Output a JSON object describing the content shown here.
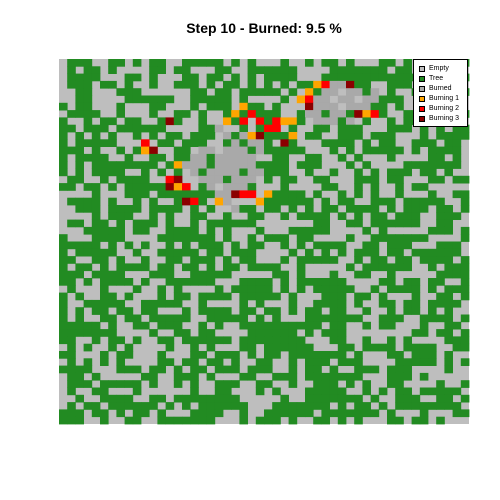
{
  "chart_data": {
    "type": "heatmap",
    "title": "Step 10 - Burned: 9.5 %",
    "step": 10,
    "burned_percent": 9.5,
    "grid_size": [
      50,
      50
    ],
    "colors": {
      "empty": "#bebebe",
      "tree": "#228b22",
      "burned": "#a9a9a9",
      "burning1": "#ffa500",
      "burning2": "#ff0000",
      "burning3": "#8b0000"
    },
    "legend": [
      {
        "label": "Empty",
        "state": "empty"
      },
      {
        "label": "Tree",
        "state": "tree"
      },
      {
        "label": "Burned",
        "state": "burned"
      },
      {
        "label": "Burning 1",
        "state": "burning1"
      },
      {
        "label": "Burning 2",
        "state": "burning2"
      },
      {
        "label": "Burning 3",
        "state": "burning3"
      }
    ],
    "legend_position": "top-right",
    "tree_density": 0.6,
    "burned_cells": [
      [
        9,
        19
      ],
      [
        10,
        20
      ],
      [
        10,
        22
      ],
      [
        11,
        21
      ],
      [
        11,
        23
      ],
      [
        11,
        24
      ],
      [
        12,
        17
      ],
      [
        12,
        18
      ],
      [
        12,
        20
      ],
      [
        12,
        21
      ],
      [
        12,
        22
      ],
      [
        12,
        24
      ],
      [
        13,
        16
      ],
      [
        13,
        17
      ],
      [
        13,
        19
      ],
      [
        13,
        20
      ],
      [
        13,
        21
      ],
      [
        13,
        22
      ],
      [
        13,
        23
      ],
      [
        14,
        15
      ],
      [
        14,
        16
      ],
      [
        14,
        17
      ],
      [
        14,
        19
      ],
      [
        14,
        20
      ],
      [
        14,
        21
      ],
      [
        14,
        22
      ],
      [
        14,
        23
      ],
      [
        15,
        16
      ],
      [
        15,
        18
      ],
      [
        15,
        19
      ],
      [
        15,
        20
      ],
      [
        15,
        21
      ],
      [
        15,
        23
      ],
      [
        15,
        24
      ],
      [
        16,
        17
      ],
      [
        16,
        18
      ],
      [
        16,
        19
      ],
      [
        16,
        21
      ],
      [
        16,
        22
      ],
      [
        16,
        23
      ],
      [
        17,
        18
      ],
      [
        17,
        20
      ],
      [
        17,
        21
      ],
      [
        17,
        22
      ],
      [
        18,
        19
      ],
      [
        18,
        20
      ],
      [
        18,
        22
      ],
      [
        19,
        20
      ],
      [
        20,
        21
      ],
      [
        3,
        33
      ],
      [
        3,
        34
      ],
      [
        4,
        32
      ],
      [
        4,
        33
      ],
      [
        4,
        35
      ],
      [
        4,
        36
      ],
      [
        4,
        38
      ],
      [
        5,
        31
      ],
      [
        5,
        32
      ],
      [
        5,
        34
      ],
      [
        5,
        35
      ],
      [
        5,
        37
      ],
      [
        5,
        38
      ],
      [
        6,
        31
      ],
      [
        6,
        32
      ],
      [
        6,
        33
      ],
      [
        6,
        35
      ],
      [
        6,
        36
      ],
      [
        6,
        37
      ],
      [
        7,
        30
      ],
      [
        7,
        31
      ],
      [
        7,
        33
      ],
      [
        7,
        34
      ],
      [
        7,
        36
      ],
      [
        8,
        31
      ],
      [
        8,
        32
      ],
      [
        8,
        33
      ],
      [
        8,
        35
      ]
    ],
    "burning1_cells": [
      [
        6,
        22
      ],
      [
        7,
        21
      ],
      [
        8,
        20
      ],
      [
        8,
        27
      ],
      [
        9,
        26
      ],
      [
        10,
        23
      ],
      [
        10,
        28
      ],
      [
        12,
        10
      ],
      [
        14,
        14
      ],
      [
        17,
        14
      ],
      [
        18,
        21
      ],
      [
        18,
        25
      ],
      [
        19,
        19
      ],
      [
        19,
        24
      ],
      [
        4,
        30
      ],
      [
        5,
        29
      ],
      [
        7,
        37
      ],
      [
        8,
        28
      ],
      [
        3,
        31
      ]
    ],
    "burning2_cells": [
      [
        7,
        23
      ],
      [
        8,
        22
      ],
      [
        9,
        25
      ],
      [
        11,
        10
      ],
      [
        12,
        11
      ],
      [
        16,
        13
      ],
      [
        18,
        22
      ],
      [
        18,
        23
      ],
      [
        3,
        32
      ],
      [
        5,
        30
      ],
      [
        7,
        38
      ],
      [
        9,
        26
      ],
      [
        19,
        16
      ],
      [
        17,
        15
      ],
      [
        8,
        24
      ],
      [
        8,
        26
      ]
    ],
    "burning3_cells": [
      [
        8,
        13
      ],
      [
        10,
        24
      ],
      [
        12,
        11
      ],
      [
        16,
        14
      ],
      [
        17,
        13
      ],
      [
        19,
        15
      ],
      [
        18,
        21
      ],
      [
        3,
        35
      ],
      [
        6,
        30
      ],
      [
        7,
        36
      ],
      [
        11,
        27
      ]
    ]
  }
}
